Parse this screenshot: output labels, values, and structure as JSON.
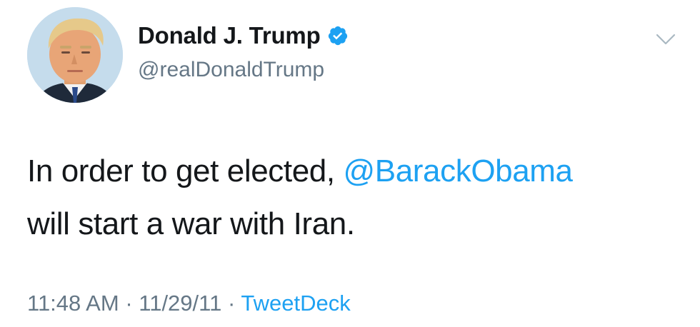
{
  "author": {
    "display_name": "Donald J. Trump",
    "handle": "@realDonaldTrump",
    "verified": true,
    "avatar_icon": "profile-photo"
  },
  "tweet": {
    "text_before_mention": "In order to get elected,",
    "mention": "@BarackObama",
    "text_after_mention": "will start a war with Iran."
  },
  "meta": {
    "time": "11:48 AM",
    "separator": "·",
    "date": "11/29/11",
    "source": "TweetDeck"
  },
  "icons": {
    "verified": "verified-badge-icon",
    "menu": "chevron-down-icon"
  },
  "colors": {
    "link_blue": "#1da1f2",
    "text_primary": "#14171a",
    "text_secondary": "#657786"
  }
}
